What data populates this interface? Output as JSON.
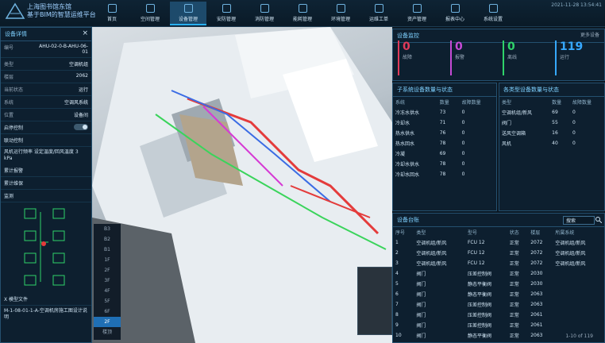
{
  "header": {
    "brand_line1": "上海图书馆东馆",
    "brand_line2": "基于BIM的智慧运维平台",
    "nav": [
      "首页",
      "空间管理",
      "设备管理",
      "安防管理",
      "消防管理",
      "能耗管理",
      "环境管理",
      "运维工单",
      "资产管理",
      "报表中心",
      "系统设置"
    ],
    "active_nav": 2,
    "status": "2021-11-28 13:54:41"
  },
  "left_panel": {
    "title": "设备详情",
    "fields": [
      {
        "k": "编号",
        "v": "AHU-02-0-B-AHU-06-01"
      },
      {
        "k": "类型",
        "v": "空调机组"
      },
      {
        "k": "楼层",
        "v": "2062"
      },
      {
        "k": "当前状态",
        "v": "运行"
      },
      {
        "k": "系统",
        "v": "空调风系统"
      },
      {
        "k": "位置",
        "v": "设备间"
      }
    ],
    "toggle1": "启停控制",
    "toggle2": "联动控制",
    "note": "风机运行频率 设定温度/回风温度 3 kPa",
    "alarm": "累计报警",
    "params": "累计维保",
    "monitor": "监测",
    "footer": "X 模型文件",
    "bottom_status": "M-1-08-01-1-A-空调机房施工图设计说明"
  },
  "stats": {
    "title": "设备监控",
    "items": [
      {
        "num": "0",
        "lbl": "故障",
        "color": "#e03a5a"
      },
      {
        "num": "0",
        "lbl": "报警",
        "color": "#c64bd6"
      },
      {
        "num": "0",
        "lbl": "离线",
        "color": "#2fd36a"
      },
      {
        "num": "119",
        "lbl": "运行",
        "color": "#36a8ff"
      }
    ],
    "link": "更多设备"
  },
  "table_left": {
    "title": "子系统设备数量与状态",
    "headers": [
      "系统",
      "数量",
      "故障数量"
    ],
    "rows": [
      [
        "冷冻水供水",
        "73",
        "0"
      ],
      [
        "冷却水",
        "71",
        "0"
      ],
      [
        "热水供水",
        "76",
        "0"
      ],
      [
        "热水回水",
        "78",
        "0"
      ],
      [
        "冷凝",
        "69",
        "0"
      ],
      [
        "冷却水供水",
        "78",
        "0"
      ],
      [
        "冷却水回水",
        "78",
        "0"
      ]
    ]
  },
  "table_right": {
    "title": "各类型设备数量与状态",
    "headers": [
      "类型",
      "数量",
      "故障数量"
    ],
    "rows": [
      [
        "空调机组/新风",
        "69",
        "0"
      ],
      [
        "阀门",
        "55",
        "0"
      ],
      [
        "送风空调箱",
        "16",
        "0"
      ],
      [
        "风机",
        "40",
        "0"
      ]
    ]
  },
  "list": {
    "title": "设备台账",
    "search_placeholder": "搜索",
    "headers": [
      "序号",
      "类型",
      "型号",
      "状态",
      "楼层",
      "所属系统"
    ],
    "rows": [
      [
        "1",
        "空调机组/新风",
        "FCU 12",
        "正常",
        "2072",
        "空调机组/新风"
      ],
      [
        "2",
        "空调机组/新风",
        "FCU 12",
        "正常",
        "2072",
        "空调机组/新风"
      ],
      [
        "3",
        "空调机组/新风",
        "FCU 12",
        "正常",
        "2072",
        "空调机组/新风"
      ],
      [
        "4",
        "阀门",
        "压差控制阀",
        "正常",
        "2030",
        ""
      ],
      [
        "5",
        "阀门",
        "静态平衡阀",
        "正常",
        "2030",
        ""
      ],
      [
        "6",
        "阀门",
        "静态平衡阀",
        "正常",
        "2063",
        ""
      ],
      [
        "7",
        "阀门",
        "压差控制阀",
        "正常",
        "2063",
        ""
      ],
      [
        "8",
        "阀门",
        "压差控制阀",
        "正常",
        "2061",
        ""
      ],
      [
        "9",
        "阀门",
        "压差控制阀",
        "正常",
        "2061",
        ""
      ],
      [
        "10",
        "阀门",
        "静态平衡阀",
        "正常",
        "2063",
        ""
      ]
    ],
    "pager": "1-10 of 119"
  },
  "floors": [
    "B3",
    "B2",
    "B1",
    "1F",
    "2F",
    "3F",
    "4F",
    "5F",
    "6F",
    "2F",
    "楼顶"
  ],
  "floor_selected": 9
}
